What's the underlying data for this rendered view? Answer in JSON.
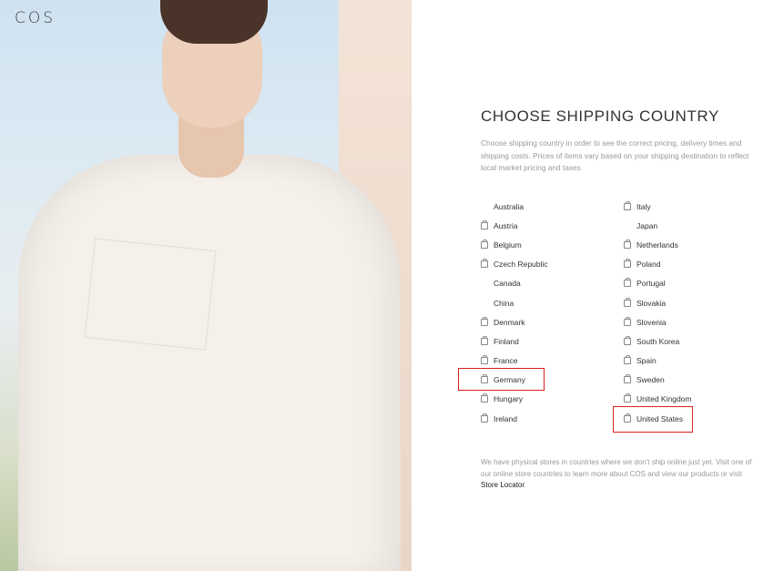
{
  "brand": "COS",
  "heading": "CHOOSE SHIPPING COUNTRY",
  "description": "Choose shipping country in order to see the correct pricing, delivery times and shipping costs. Prices of items vary based on your shipping destination to reflect local market pricing and taxes",
  "countries_left": [
    {
      "name": "Australia",
      "icon": ""
    },
    {
      "name": "Austria",
      "icon": "bag-icon"
    },
    {
      "name": "Belgium",
      "icon": "bag-icon"
    },
    {
      "name": "Czech Republic",
      "icon": "bag-icon"
    },
    {
      "name": "Canada",
      "icon": ""
    },
    {
      "name": "China",
      "icon": ""
    },
    {
      "name": "Denmark",
      "icon": "bag-icon"
    },
    {
      "name": "Finland",
      "icon": "bag-icon"
    },
    {
      "name": "France",
      "icon": "bag-icon"
    },
    {
      "name": "Germany",
      "icon": "bag-icon"
    },
    {
      "name": "Hungary",
      "icon": "bag-icon"
    },
    {
      "name": "Ireland",
      "icon": "bag-icon"
    }
  ],
  "countries_right": [
    {
      "name": "Italy",
      "icon": "bag-icon"
    },
    {
      "name": "Japan",
      "icon": ""
    },
    {
      "name": "Netherlands",
      "icon": "bag-icon"
    },
    {
      "name": "Poland",
      "icon": "bag-icon"
    },
    {
      "name": "Portugal",
      "icon": "bag-icon"
    },
    {
      "name": "Slovakia",
      "icon": "bag-icon"
    },
    {
      "name": "Slovenia",
      "icon": "bag-icon"
    },
    {
      "name": "South Korea",
      "icon": "bag-icon"
    },
    {
      "name": "Spain",
      "icon": "bag-icon"
    },
    {
      "name": "Sweden",
      "icon": "bag-icon"
    },
    {
      "name": "United Kingdom",
      "icon": "bag-icon"
    },
    {
      "name": "United States",
      "icon": "bag-icon"
    }
  ],
  "footer": {
    "text": "We have physical stores in countries where we don't ship online just yet. Visit one of our online store countries to learn more about COS and view our products or visit ",
    "link": "Store Locator",
    "end": "."
  },
  "colors": {
    "highlight": "#d9211e",
    "text": "#333333",
    "muted": "#999999"
  }
}
